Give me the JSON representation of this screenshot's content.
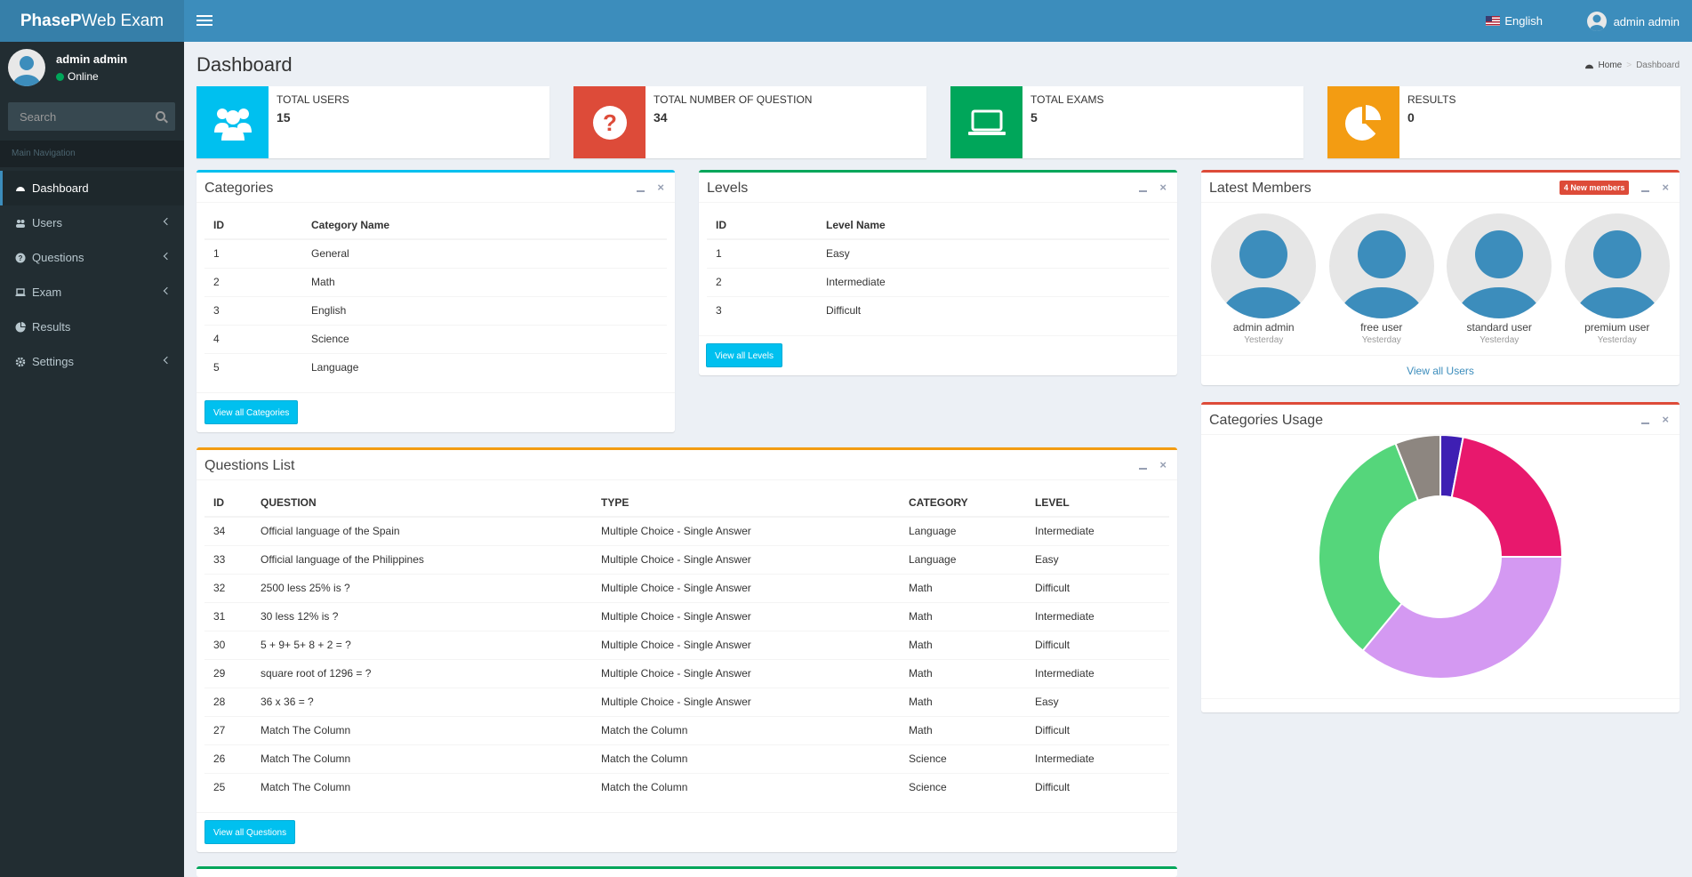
{
  "app": {
    "logo_bold": "PhaseP",
    "logo_rest": "Web Exam"
  },
  "topbar": {
    "language": "English",
    "user": "admin admin"
  },
  "sidebar": {
    "user_name": "admin admin",
    "status": "Online",
    "search_placeholder": "Search",
    "nav_header": "Main Navigation",
    "items": [
      {
        "label": "Dashboard",
        "icon": "dashboard-icon"
      },
      {
        "label": "Users",
        "icon": "users-icon"
      },
      {
        "label": "Questions",
        "icon": "question-circle-icon"
      },
      {
        "label": "Exam",
        "icon": "laptop-icon"
      },
      {
        "label": "Results",
        "icon": "pie-chart-icon"
      },
      {
        "label": "Settings",
        "icon": "gear-icon"
      }
    ]
  },
  "page": {
    "title": "Dashboard",
    "breadcrumb": [
      "Home",
      "Dashboard"
    ]
  },
  "stats": [
    {
      "label": "TOTAL USERS",
      "value": "15",
      "color": "#00c0ef",
      "icon": "users-icon"
    },
    {
      "label": "TOTAL NUMBER OF QUESTION",
      "value": "34",
      "color": "#dd4b39",
      "icon": "question-circle-icon"
    },
    {
      "label": "TOTAL EXAMS",
      "value": "5",
      "color": "#00a65a",
      "icon": "laptop-icon"
    },
    {
      "label": "RESULTS",
      "value": "0",
      "color": "#f39c12",
      "icon": "pie-chart-icon"
    }
  ],
  "categories": {
    "title": "Categories",
    "headers": [
      "ID",
      "Category Name"
    ],
    "rows": [
      [
        "1",
        "General"
      ],
      [
        "2",
        "Math"
      ],
      [
        "3",
        "English"
      ],
      [
        "4",
        "Science"
      ],
      [
        "5",
        "Language"
      ]
    ],
    "button": "View all Categories"
  },
  "levels": {
    "title": "Levels",
    "headers": [
      "ID",
      "Level Name"
    ],
    "rows": [
      [
        "1",
        "Easy"
      ],
      [
        "2",
        "Intermediate"
      ],
      [
        "3",
        "Difficult"
      ]
    ],
    "button": "View all Levels"
  },
  "questions": {
    "title": "Questions List",
    "headers": [
      "ID",
      "QUESTION",
      "TYPE",
      "CATEGORY",
      "LEVEL"
    ],
    "rows": [
      [
        "34",
        "Official language of the Spain",
        "Multiple Choice - Single Answer",
        "Language",
        "Intermediate"
      ],
      [
        "33",
        "Official language of the Philippines",
        "Multiple Choice - Single Answer",
        "Language",
        "Easy"
      ],
      [
        "32",
        "2500 less 25% is ?",
        "Multiple Choice - Single Answer",
        "Math",
        "Difficult"
      ],
      [
        "31",
        "30 less 12% is ?",
        "Multiple Choice - Single Answer",
        "Math",
        "Intermediate"
      ],
      [
        "30",
        "5 + 9+ 5+ 8 + 2 = ?",
        "Multiple Choice - Single Answer",
        "Math",
        "Difficult"
      ],
      [
        "29",
        "square root of 1296 = ?",
        "Multiple Choice - Single Answer",
        "Math",
        "Intermediate"
      ],
      [
        "28",
        "36 x 36 = ?",
        "Multiple Choice - Single Answer",
        "Math",
        "Easy"
      ],
      [
        "27",
        "Match The Column",
        "Match the Column",
        "Math",
        "Difficult"
      ],
      [
        "26",
        "Match The Column",
        "Match the Column",
        "Science",
        "Intermediate"
      ],
      [
        "25",
        "Match The Column",
        "Match the Column",
        "Science",
        "Difficult"
      ]
    ],
    "button": "View all Questions"
  },
  "members": {
    "title": "Latest Members",
    "badge": "4 New members",
    "list": [
      {
        "name": "admin admin",
        "date": "Yesterday"
      },
      {
        "name": "free user",
        "date": "Yesterday"
      },
      {
        "name": "standard user",
        "date": "Yesterday"
      },
      {
        "name": "premium user",
        "date": "Yesterday"
      }
    ],
    "link": "View all Users"
  },
  "usage": {
    "title": "Categories Usage"
  },
  "chart_data": {
    "type": "pie",
    "donut": true,
    "values": [
      3,
      22,
      36,
      33,
      6
    ],
    "colors": [
      "#3e1fb3",
      "#e8186d",
      "#d499f2",
      "#55d67b",
      "#8d8680"
    ]
  }
}
